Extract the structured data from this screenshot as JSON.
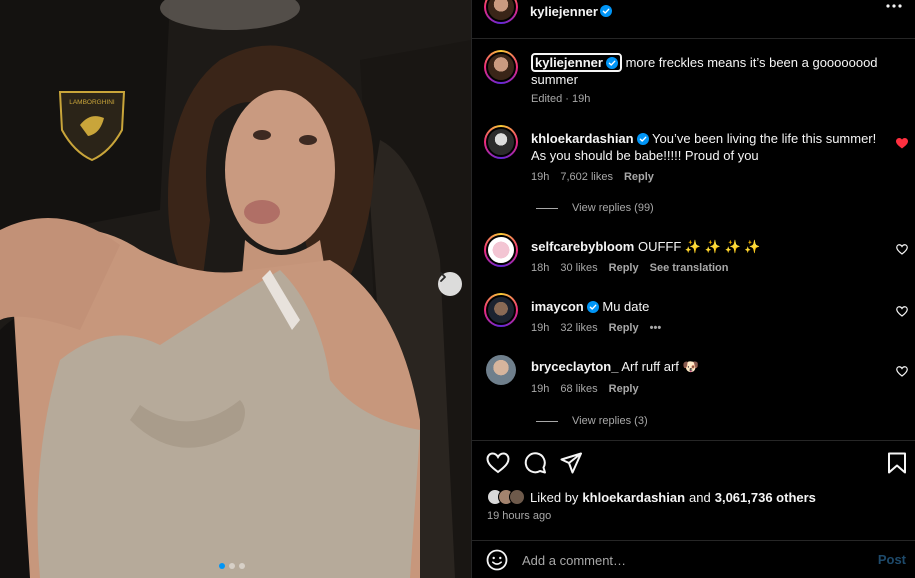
{
  "media": {
    "logo_text": "LAMBORGHINI",
    "carousel": {
      "count": 3,
      "active": 0
    }
  },
  "post": {
    "author": "kyliejenner",
    "caption": "more freckles means it’s been a goooooood summer",
    "caption_meta": "Edited · 19h"
  },
  "comments": [
    {
      "user": "khloekardashian",
      "verified": true,
      "text": "You’ve been living the life this summer! As you should be babe!!!!! Proud of you",
      "time": "19h",
      "likes": "7,602 likes",
      "reply": "Reply",
      "liked": true,
      "view_replies": "View replies (99)"
    },
    {
      "user": "selfcarebybloom",
      "verified": false,
      "text": "OUFFF ✨ ✨ ✨ ✨",
      "time": "18h",
      "likes": "30 likes",
      "reply": "Reply",
      "extra": "See translation"
    },
    {
      "user": "imaycon",
      "verified": true,
      "text": "Mu date",
      "time": "19h",
      "likes": "32 likes",
      "reply": "Reply",
      "extra": "•••"
    },
    {
      "user": "bryceclayton_",
      "verified": false,
      "text": "Arf ruff arf 🐶",
      "time": "19h",
      "likes": "68 likes",
      "reply": "Reply",
      "view_replies": "View replies (3)"
    }
  ],
  "likes": {
    "prefix": "Liked by",
    "user": "khloekardashian",
    "joiner": "and",
    "count": "3,061,736 others"
  },
  "posted_ago": "19 hours ago",
  "comment_box": {
    "placeholder": "Add a comment…",
    "post_label": "Post"
  },
  "colors": {
    "accent": "#0095f6",
    "like_red": "#ff3040",
    "muted": "#a8a8a8"
  }
}
